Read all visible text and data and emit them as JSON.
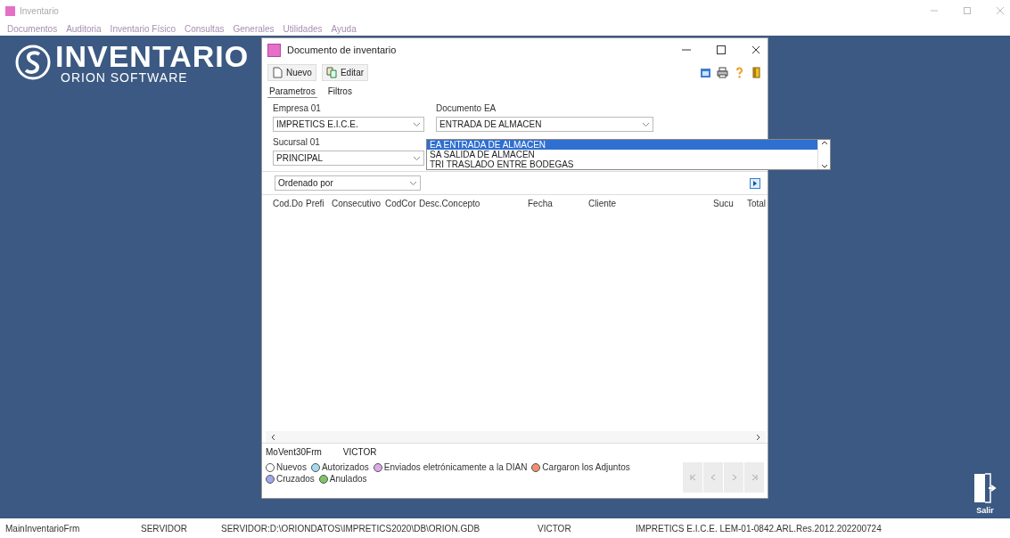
{
  "window": {
    "title": "Inventario"
  },
  "menu": [
    "Documentos",
    "Auditoria",
    "Inventario Físico",
    "Consultas",
    "Generales",
    "Utilidades",
    "Ayuda"
  ],
  "logo": {
    "title": "INVENTARIO",
    "subtitle": "ORION SOFTWARE"
  },
  "dialog": {
    "title": "Documento de inventario",
    "toolbar": [
      {
        "label": "Nuevo",
        "kind": "new"
      },
      {
        "label": "Editar",
        "kind": "edit"
      }
    ],
    "tabs": [
      {
        "label": "Parametros",
        "selected": true
      },
      {
        "label": "Filtros",
        "selected": false
      }
    ],
    "empresa": {
      "label": "Empresa  01",
      "value": "IMPRETICS E.I.C.E."
    },
    "documento": {
      "label": "Documento  EA",
      "value": "ENTRADA  DE ALMACEN",
      "expanded": true,
      "options": [
        {
          "label": "EA  ENTRADA  DE ALMACEN",
          "selected": true
        },
        {
          "label": "SA   SALIDA  DE ALMACEN",
          "selected": false
        },
        {
          "label": "TRI  TRASLADO ENTRE BODEGAS",
          "selected": false
        }
      ]
    },
    "sucursal": {
      "label": "Sucursal  01",
      "value": "PRINCIPAL"
    },
    "order_by": {
      "value": "Ordenado por"
    },
    "table": {
      "columns": [
        "Cod.Do",
        "Prefi",
        "Consecutivo",
        "CodCor",
        "Desc.Concepto",
        "Fecha",
        "Cliente",
        "Sucu",
        "Total"
      ]
    },
    "footer": {
      "form": "MoVent30Frm",
      "user": "VICTOR"
    },
    "legend": [
      {
        "label": "Nuevos",
        "color": "#ffffff"
      },
      {
        "label": "Autorizados",
        "color": "#a8d8ee"
      },
      {
        "label": "Enviados eletrónicamente a la DIAN",
        "color": "#dcaae6"
      },
      {
        "label": "Cargaron los Adjuntos",
        "color": "#f0906c"
      },
      {
        "label": "Cruzados",
        "color": "#9ea8ea"
      },
      {
        "label": "Anulados",
        "color": "#80c46a"
      }
    ]
  },
  "exit": {
    "label": "Salir"
  },
  "status_bar": [
    "MainInventarioFrm",
    "SERVIDOR",
    "SERVIDOR:D:\\ORIONDATOS\\IMPRETICS2020\\DB\\ORION.GDB",
    "VICTOR",
    "IMPRETICS E.I.C.E. LEM-01-0842.ARL.Res.2012.202200724"
  ]
}
